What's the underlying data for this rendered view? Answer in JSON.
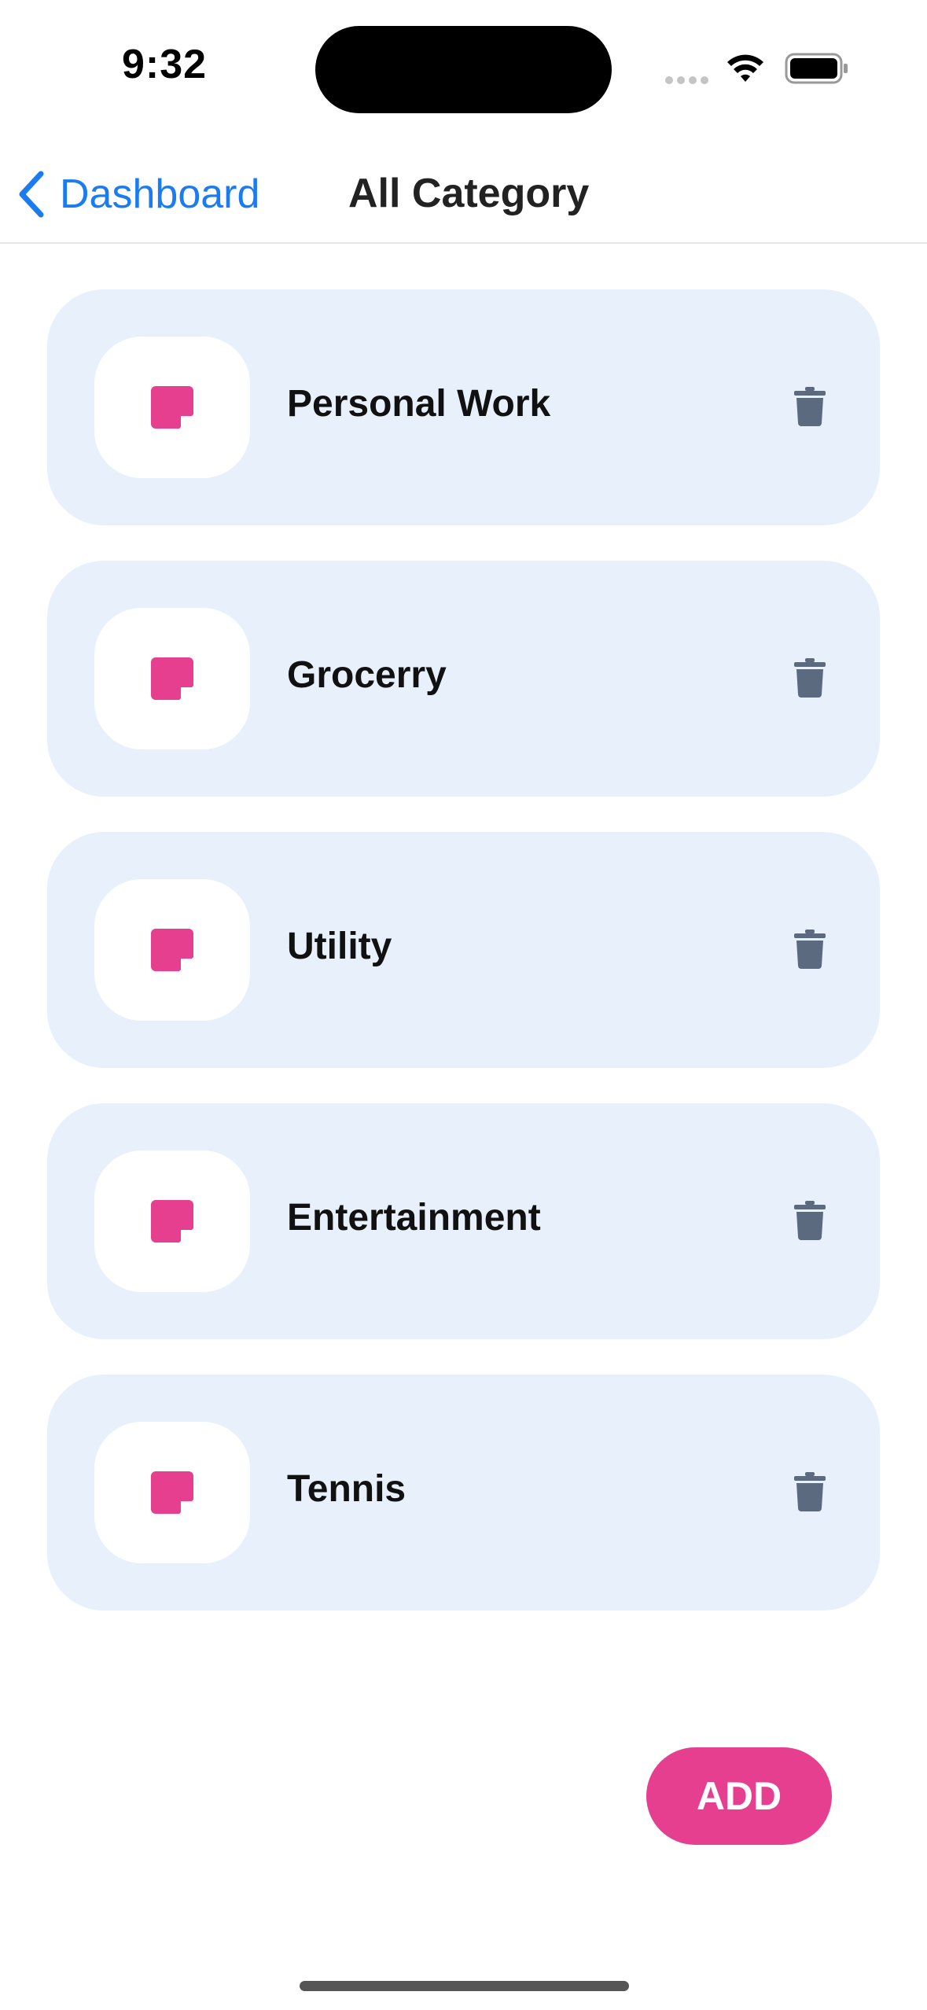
{
  "status_bar": {
    "time": "9:32"
  },
  "nav": {
    "back_label": "Dashboard",
    "title": "All Category"
  },
  "categories": [
    {
      "name": "Personal Work",
      "icon": "note-icon"
    },
    {
      "name": "Grocerry",
      "icon": "note-icon"
    },
    {
      "name": "Utility",
      "icon": "note-icon"
    },
    {
      "name": "Entertainment",
      "icon": "note-icon"
    },
    {
      "name": "Tennis",
      "icon": "note-icon"
    }
  ],
  "actions": {
    "add_label": "ADD"
  },
  "colors": {
    "accent": "#e63f8f",
    "link": "#1a7cf0",
    "card_background": "#e8f0fc",
    "delete_icon": "#5b6a7e"
  }
}
